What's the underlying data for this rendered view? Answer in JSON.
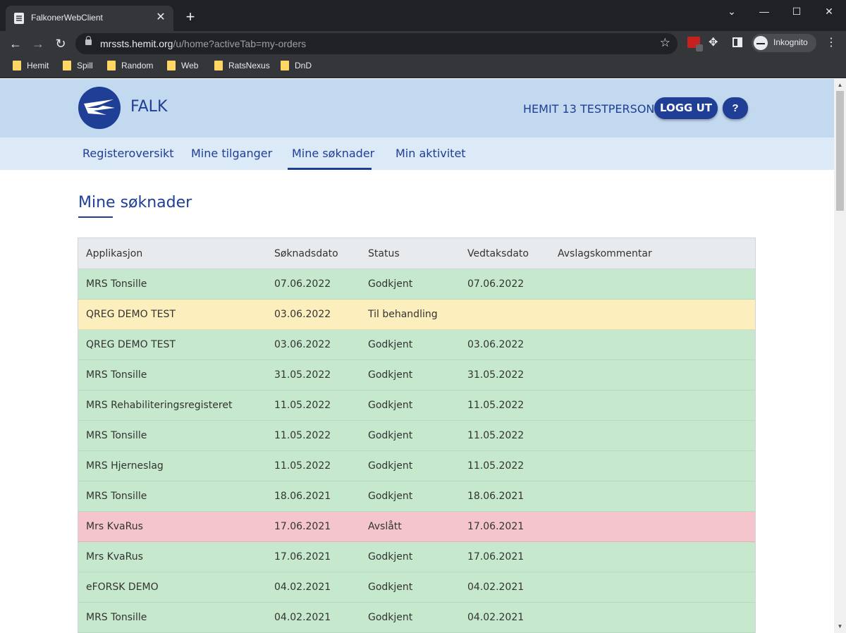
{
  "browser": {
    "tab_title": "FalkonerWebClient",
    "url_host": "mrssts.hemit.org",
    "url_path": "/u/home?activeTab=my-orders",
    "profile_label": "Inkognito",
    "bookmarks": [
      "Hemit",
      "Spill",
      "Random",
      "Web",
      "RatsNexus",
      "DnD"
    ]
  },
  "header": {
    "brand": "FALK",
    "user_name": "HEMIT 13 TESTPERSON",
    "logout_label": "LOGG UT",
    "help_label": "?"
  },
  "nav": {
    "items": [
      "Registeroversikt",
      "Mine tilganger",
      "Mine søknader",
      "Min aktivitet"
    ],
    "active": "Mine søknader"
  },
  "main": {
    "title": "Mine søknader",
    "columns": [
      "Applikasjon",
      "Søknadsdato",
      "Status",
      "Vedtaksdato",
      "Avslagskommentar"
    ],
    "rows": [
      {
        "app": "MRS Tonsille",
        "applied": "07.06.2022",
        "status": "Godkjent",
        "decided": "07.06.2022",
        "comment": "",
        "state": "approved"
      },
      {
        "app": "QREG DEMO TEST",
        "applied": "03.06.2022",
        "status": "Til behandling",
        "decided": "",
        "comment": "",
        "state": "pending"
      },
      {
        "app": "QREG DEMO TEST",
        "applied": "03.06.2022",
        "status": "Godkjent",
        "decided": "03.06.2022",
        "comment": "",
        "state": "approved"
      },
      {
        "app": "MRS Tonsille",
        "applied": "31.05.2022",
        "status": "Godkjent",
        "decided": "31.05.2022",
        "comment": "",
        "state": "approved"
      },
      {
        "app": "MRS Rehabiliteringsregisteret",
        "applied": "11.05.2022",
        "status": "Godkjent",
        "decided": "11.05.2022",
        "comment": "",
        "state": "approved"
      },
      {
        "app": "MRS Tonsille",
        "applied": "11.05.2022",
        "status": "Godkjent",
        "decided": "11.05.2022",
        "comment": "",
        "state": "approved"
      },
      {
        "app": "MRS Hjerneslag",
        "applied": "11.05.2022",
        "status": "Godkjent",
        "decided": "11.05.2022",
        "comment": "",
        "state": "approved"
      },
      {
        "app": "MRS Tonsille",
        "applied": "18.06.2021",
        "status": "Godkjent",
        "decided": "18.06.2021",
        "comment": "",
        "state": "approved"
      },
      {
        "app": "Mrs KvaRus",
        "applied": "17.06.2021",
        "status": "Avslått",
        "decided": "17.06.2021",
        "comment": "",
        "state": "rejected"
      },
      {
        "app": "Mrs KvaRus",
        "applied": "17.06.2021",
        "status": "Godkjent",
        "decided": "17.06.2021",
        "comment": "",
        "state": "approved"
      },
      {
        "app": "eFORSK DEMO",
        "applied": "04.02.2021",
        "status": "Godkjent",
        "decided": "04.02.2021",
        "comment": "",
        "state": "approved"
      },
      {
        "app": "MRS Tonsille",
        "applied": "04.02.2021",
        "status": "Godkjent",
        "decided": "04.02.2021",
        "comment": "",
        "state": "approved"
      }
    ]
  },
  "colors": {
    "brand": "#1f3e96",
    "header_bg": "#c3d9ef",
    "nav_bg": "#dce9f6",
    "approved": "#c6e8cc",
    "pending": "#fcefbd",
    "rejected": "#f4c5cc"
  }
}
